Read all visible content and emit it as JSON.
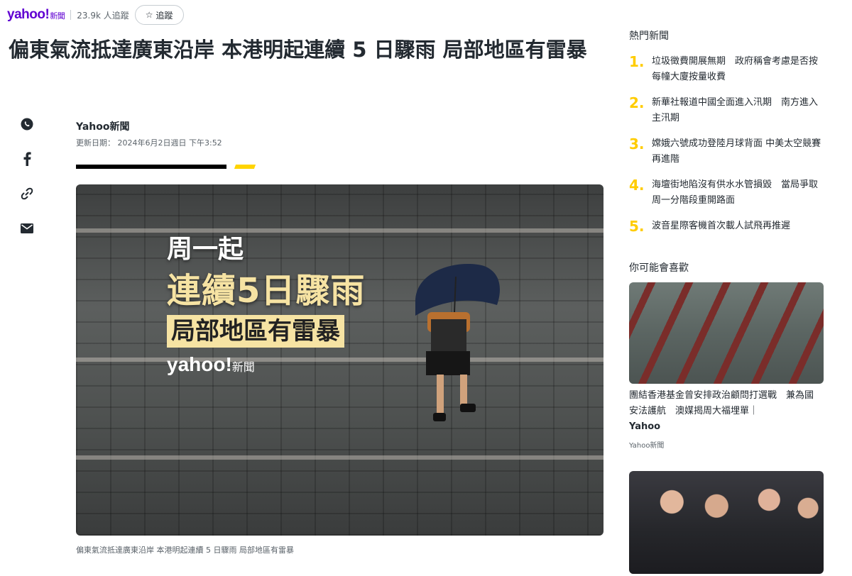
{
  "brand": {
    "logo": "yahoo!",
    "logo_sub": "新聞"
  },
  "followers": "23.9k 人追蹤",
  "follow_button": "追蹤",
  "headline": "偏東氣流抵達廣東沿岸 本港明起連續 5 日驟雨 局部地區有雷暴",
  "author": "Yahoo新聞",
  "updated": "更新日期： 2024年6月2日週日 下午3:52",
  "share_icons": [
    "whatsapp-icon",
    "facebook-icon",
    "link-icon",
    "email-icon"
  ],
  "hero": {
    "line1": "周一起",
    "line2": "連續5日驟雨",
    "line3": "局部地區有雷暴",
    "logo": "yahoo!",
    "logo_sub": "新聞"
  },
  "caption": "偏東氣流抵達廣東沿岸 本港明起連續 5 日驟雨 局部地區有雷暴",
  "sidebar": {
    "trending_heading": "熱門新聞",
    "trending": [
      {
        "num": "1.",
        "text": "垃圾徵費開展無期　政府稱會考慮是否按每幢大廈按量收費"
      },
      {
        "num": "2.",
        "text": "新華社報道中國全面進入汛期　南方進入主汛期"
      },
      {
        "num": "3.",
        "text": "嫦娥六號成功登陸月球背面 中美太空競賽再進階"
      },
      {
        "num": "4.",
        "text": "海壇街地陷沒有供水水管損毀　當局爭取周一分階段重開路面"
      },
      {
        "num": "5.",
        "text": "波音星際客機首次載人試飛再推遲"
      }
    ],
    "recommend_heading": "你可能會喜歡",
    "rec1_title": "團結香港基金曾安排政治顧問打選戰　兼為國安法護航　澳媒揭周大福埋單｜",
    "rec1_title_bold": "Yahoo",
    "rec1_source": "Yahoo新聞"
  }
}
